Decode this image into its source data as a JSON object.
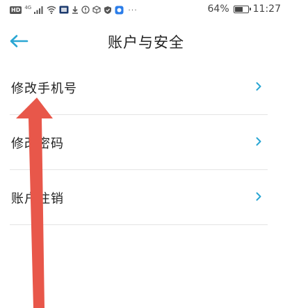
{
  "status_bar": {
    "hd_label": "HD",
    "network_label": "4G",
    "more_dots": "···",
    "battery_text": "64%",
    "battery_level": 0.64,
    "time": "11:27"
  },
  "header": {
    "title": "账户与安全",
    "back_icon": "arrow-left-icon"
  },
  "menu": {
    "items": [
      {
        "label": "修改手机号",
        "icon": "chevron-right-icon"
      },
      {
        "label": "修改密码",
        "icon": "chevron-right-icon"
      },
      {
        "label": "账户注销",
        "icon": "chevron-right-icon"
      }
    ]
  },
  "colors": {
    "accent": "#29a6d3",
    "annotation": "#e8574a",
    "divider": "#e4e4e4"
  }
}
